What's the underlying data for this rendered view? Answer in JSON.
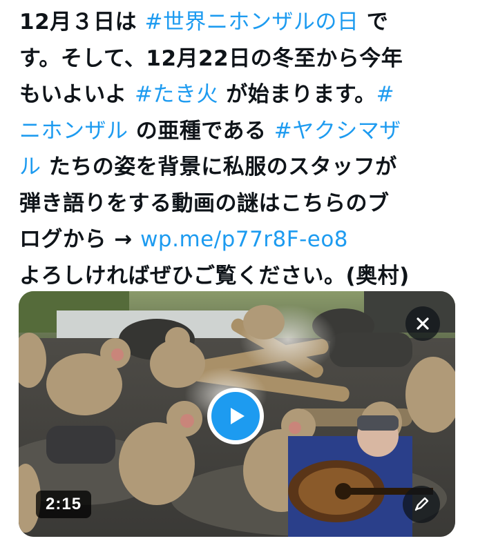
{
  "tweet": {
    "lines": [
      [
        {
          "t": "12月３日は "
        },
        {
          "t": "#世界ニホンザルの日",
          "link": true
        },
        {
          "t": " で"
        }
      ],
      [
        {
          "t": "す。そして、12月22日の冬至から今年"
        }
      ],
      [
        {
          "t": "もいよいよ "
        },
        {
          "t": "#たき火",
          "link": true
        },
        {
          "t": " が始まります。"
        },
        {
          "t": "#",
          "link": true
        }
      ],
      [
        {
          "t": "ニホンザル",
          "link": true
        },
        {
          "t": " の亜種である "
        },
        {
          "t": "#ヤクシマザ",
          "link": true
        }
      ],
      [
        {
          "t": "ル",
          "link": true
        },
        {
          "t": " たちの姿を背景に私服のスタッフが"
        }
      ],
      [
        {
          "t": "弾き語りをする動画の謎はこちらのブ"
        }
      ],
      [
        {
          "t": "ログから → "
        },
        {
          "t": "wp.me/p77r8F-eo8",
          "link": true
        }
      ],
      [
        {
          "t": "よろしければぜひご覧ください。(奥村)"
        }
      ]
    ]
  },
  "media": {
    "duration": "2:15",
    "icons": {
      "play": "play-icon",
      "close": "close-icon",
      "edit": "pencil-icon"
    }
  },
  "colors": {
    "link": "#1d9bf0",
    "text": "#0f1419",
    "play": "#1d9bf0"
  }
}
